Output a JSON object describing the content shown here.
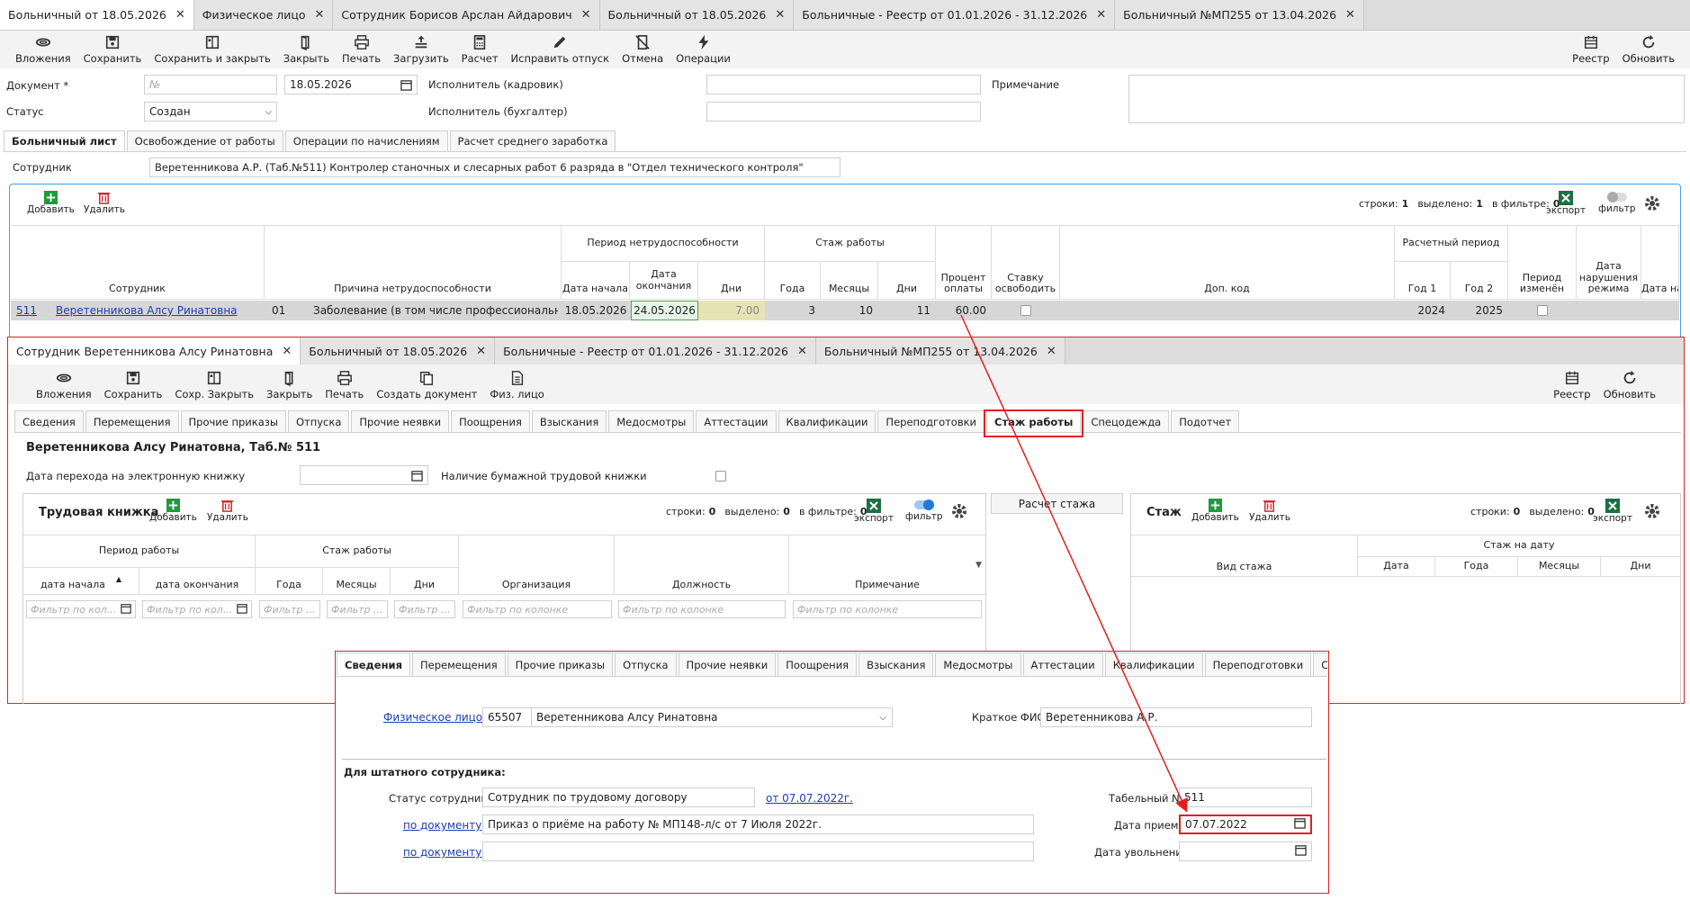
{
  "top_tabs": [
    "Больничный от 18.05.2026",
    "Физическое лицо",
    "Сотрудник Борисов Арслан Айдарович",
    "Больничный от 18.05.2026",
    "Больничные - Реестр от 01.01.2026 - 31.12.2026",
    "Больничный №МП255 от 13.04.2026"
  ],
  "toolbar1": {
    "attach": "Вложения",
    "save": "Сохранить",
    "save_close": "Сохранить и закрыть",
    "close": "Закрыть",
    "print": "Печать",
    "load": "Загрузить",
    "calc": "Расчет",
    "fix_vac": "Исправить отпуск",
    "cancel": "Отмена",
    "ops": "Операции",
    "registry": "Реестр",
    "refresh": "Обновить"
  },
  "doc": {
    "doc_label": "Документ *",
    "doc_placeholder": "№",
    "date": "18.05.2026",
    "status_label": "Статус",
    "status": "Создан",
    "exec_hr": "Исполнитель (кадровик)",
    "exec_acc": "Исполнитель (бухгалтер)",
    "note": "Примечание"
  },
  "form_tabs1": [
    "Больничный лист",
    "Освобождение от работы",
    "Операции по начислениям",
    "Расчет среднего заработка"
  ],
  "employee": {
    "label": "Сотрудник",
    "value": "Веретенникова А.Р. (Таб.№511) Контролер станочных и слесарных работ 6 разряда в \"Отдел технического контроля\""
  },
  "grid1": {
    "add": "Добавить",
    "del": "Удалить",
    "rows": "строки:",
    "rows_n": "1",
    "sel": "выделено:",
    "sel_n": "1",
    "filt": "в фильтре:",
    "filt_n": "0",
    "export": "экспорт",
    "filter": "фильтр",
    "h_employee": "Сотрудник",
    "h_reason": "Причина нетрудоспособности",
    "h_period": "Период нетрудоспособности",
    "h_start": "Дата начала",
    "h_end": "Дата окончания",
    "h_days": "Дни",
    "h_stazh": "Стаж работы",
    "h_years": "Года",
    "h_months": "Месяцы",
    "h_sdays": "Дни",
    "h_pct": "Процент оплаты",
    "h_rate": "Ставку освободить",
    "h_code": "Доп. код",
    "h_calc": "Расчетный период",
    "h_y1": "Год 1",
    "h_y2": "Год 2",
    "h_pchg": "Период изменён",
    "h_viol": "Дата нарушения режима",
    "h_paystart": "Дата начала оплаты",
    "row": {
      "tab": "511",
      "name": "Веретенникова Алсу Ринатовна",
      "code": "01",
      "reason": "Заболевание (в том числе профессиональное ...",
      "start": "18.05.2026",
      "end": "24.05.2026",
      "days": "7.00",
      "years": "3",
      "months": "10",
      "sdays": "11",
      "pct": "60.00",
      "y1": "2024",
      "y2": "2025"
    }
  },
  "tabs2": [
    "Сотрудник Веретенникова Алсу Ринатовна",
    "Больничный от 18.05.2026",
    "Больничные - Реестр от 01.01.2026 - 31.12.2026",
    "Больничный №МП255 от 13.04.2026"
  ],
  "toolbar2": {
    "attach": "Вложения",
    "save": "Сохранить",
    "save_close": "Сохр. Закрыть",
    "close": "Закрыть",
    "print": "Печать",
    "create": "Создать документ",
    "phys": "Физ. лицо",
    "registry": "Реестр",
    "refresh": "Обновить"
  },
  "form_tabs2": [
    "Сведения",
    "Перемещения",
    "Прочие приказы",
    "Отпуска",
    "Прочие неявки",
    "Поощрения",
    "Взыскания",
    "Медосмотры",
    "Аттестации",
    "Квалификации",
    "Переподготовки",
    "Стаж работы",
    "Спецодежда",
    "Подотчет"
  ],
  "emp2": {
    "title": "Веретенникова Алсу Ринатовна, Таб.№ 511",
    "ebook_label": "Дата перехода на электронную книжку",
    "paper_label": "Наличие бумажной трудовой книжки"
  },
  "labor": {
    "title": "Трудовая книжка",
    "add": "Добавить",
    "del": "Удалить",
    "rows": "строки:",
    "rows_n": "0",
    "sel": "выделено:",
    "sel_n": "0",
    "filt": "в фильтре:",
    "filt_n": "0",
    "export": "экспорт",
    "filter": "фильтр",
    "h_period": "Период работы",
    "h_stazh": "Стаж работы",
    "h_start": "дата начала",
    "h_end": "дата окончания",
    "h_years": "Года",
    "h_months": "Месяцы",
    "h_days": "Дни",
    "h_org": "Организация",
    "h_pos": "Должность",
    "h_note": "Примечание",
    "ph": "Фильтр по кол...",
    "ph_short": "Фильтр ...",
    "ph_long": "Фильтр по колонке"
  },
  "calc_btn": "Расчет стажа",
  "stazh": {
    "title": "Стаж",
    "add": "Добавить",
    "del": "Удалить",
    "rows": "строки:",
    "rows_n": "0",
    "sel": "выделено:",
    "sel_n": "0",
    "export": "экспорт",
    "h_kind": "Вид стажа",
    "h_on_date": "Стаж на дату",
    "h_date": "Дата",
    "h_years": "Года",
    "h_months": "Месяцы",
    "h_days": "Дни"
  },
  "form_tabs3": [
    "Сведения",
    "Перемещения",
    "Прочие приказы",
    "Отпуска",
    "Прочие неявки",
    "Поощрения",
    "Взыскания",
    "Медосмотры",
    "Аттестации",
    "Квалификации",
    "Переподготовки",
    "Стаж работы",
    "Спецо"
  ],
  "info": {
    "phys_link": "Физическое лицо",
    "phys_id": "65507",
    "phys_name": "Веретенникова Алсу Ринатовна",
    "short_label": "Краткое ФИО",
    "short_val": "Веретенникова А.Р.",
    "section": "Для штатного сотрудника:",
    "status_label": "Статус сотрудника",
    "status_val": "Сотрудник по трудовому договору",
    "status_date": "от 07.07.2022г.",
    "doc_link": "по документу",
    "doc_val": "Приказ о приёме на работу № МП148-л/с от 7 Июля 2022г.",
    "doc_link2": "по документу",
    "tab_label": "Табельный №",
    "tab_val": "511",
    "hire_label": "Дата приема",
    "hire_val": "07.07.2022",
    "fire_label": "Дата увольнения"
  },
  "colors": {
    "accent_red": "#e02020",
    "link": "#1a3fb3",
    "green": "#1e7b3c",
    "excel": "#1d6f42"
  }
}
